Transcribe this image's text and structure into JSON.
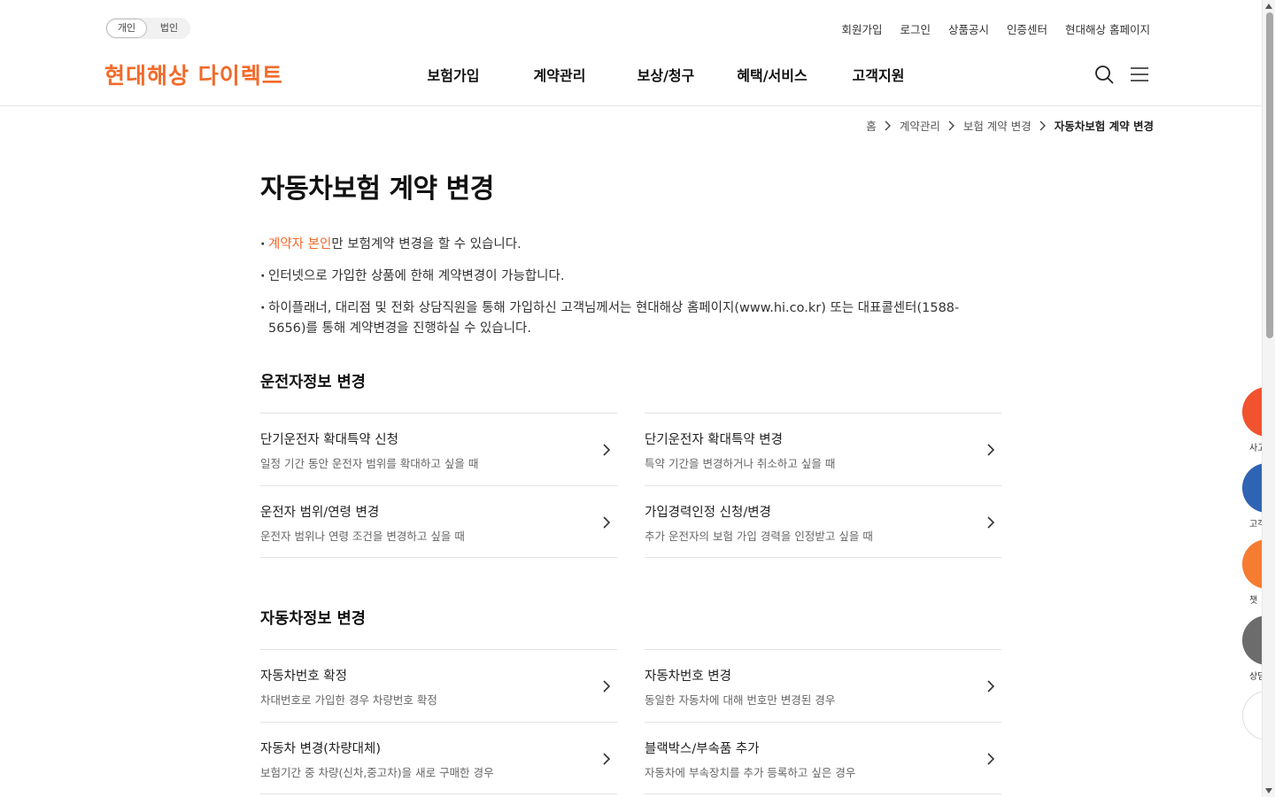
{
  "header": {
    "segment": {
      "personal": "개인",
      "corporate": "법인"
    },
    "util_links": [
      "회원가입",
      "로그인",
      "상품공시",
      "인증센터",
      "현대해상 홈페이지"
    ],
    "logo": "현대해상 다이렉트",
    "gnb": [
      "보험가입",
      "계약관리",
      "보상/청구",
      "혜택/서비스",
      "고객지원"
    ]
  },
  "breadcrumb": [
    "홈",
    "계약관리",
    "보험 계약 변경",
    "자동차보험 계약 변경"
  ],
  "page_title": "자동차보험 계약 변경",
  "notes": {
    "n1_highlight": "계약자 본인",
    "n1_rest": "만 보험계약 변경을 할 수 있습니다.",
    "n2": "인터넷으로 가입한 상품에 한해 계약변경이 가능합니다.",
    "n3": "하이플래너, 대리점 및 전화 상담직원을 통해 가입하신 고객님께서는 현대해상 홈페이지(www.hi.co.kr) 또는 대표콜센터(1588-5656)를 통해 계약변경을 진행하실 수 있습니다."
  },
  "sections": [
    {
      "title": "운전자정보 변경",
      "items": [
        {
          "title": "단기운전자 확대특약 신청",
          "desc": "일정 기간 동안 운전자 범위를 확대하고 싶을 때"
        },
        {
          "title": "단기운전자 확대특약 변경",
          "desc": "특약 기간을 변경하거나 취소하고 싶을 때"
        },
        {
          "title": "운전자 범위/연령 변경",
          "desc": "운전자 범위나 연령 조건을 변경하고 싶을 때"
        },
        {
          "title": "가입경력인정 신청/변경",
          "desc": "추가 운전자의 보험 가입 경력을 인정받고 싶을 때"
        }
      ]
    },
    {
      "title": "자동차정보 변경",
      "items": [
        {
          "title": "자동차번호 확정",
          "desc": "차대번호로 가입한 경우 차량번호 확정"
        },
        {
          "title": "자동차번호 변경",
          "desc": "동일한 자동차에 대해 번호만 변경된 경우"
        },
        {
          "title": "자동차 변경(차량대체)",
          "desc": "보험기간 중 차량(신차,중고차)을 새로 구매한 경우"
        },
        {
          "title": "블랙박스/부속품 추가",
          "desc": "자동차에 부속장치를 추가 등록하고 싶은 경우"
        }
      ]
    }
  ],
  "floating": {
    "labels": [
      "사고",
      "고객",
      "챗",
      "상담"
    ],
    "colors": [
      "#f0532e",
      "#2f64b5",
      "#f57c31",
      "#6c6c6c"
    ]
  },
  "colors": {
    "accent": "#f26a2a"
  }
}
